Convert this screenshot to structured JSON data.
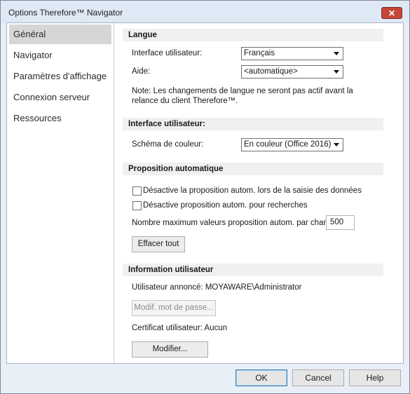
{
  "window": {
    "title": "Options Therefore™ Navigator",
    "close_glyph": "✕"
  },
  "sidebar": {
    "items": [
      {
        "label": "Général",
        "active": true
      },
      {
        "label": "Navigator",
        "active": false
      },
      {
        "label": "Paramètres d'affichage",
        "active": false
      },
      {
        "label": "Connexion serveur",
        "active": false
      },
      {
        "label": "Ressources",
        "active": false
      }
    ]
  },
  "langue": {
    "header": "Langue",
    "ui_label": "Interface utilisateur:",
    "ui_value": "Français",
    "help_label": "Aide:",
    "help_value": "<automatique>",
    "note_line1": "Note: Les changements de langue ne seront pas actif avant la",
    "note_line2": "relance du client Therefore™."
  },
  "interface": {
    "header": "Interface utilisateur:",
    "scheme_label": "Schéma de couleur:",
    "scheme_value": "En couleur (Office 2016)"
  },
  "autocomplete": {
    "header": "Proposition automatique",
    "check1_label": "Désactive la proposition autom. lors de la saisie des données",
    "check1_checked": false,
    "check2_label": "Désactive proposition autom. pour recherches",
    "check2_checked": false,
    "max_label": "Nombre maximum valeurs proposition autom. par champ:",
    "max_value": "500",
    "clear_button": "Effacer tout"
  },
  "userinfo": {
    "header": "Information utilisateur",
    "logged_user": "Utilisateur annoncé: MOYAWARE\\Administrator",
    "change_pwd_button": "Modif. mot de passe...",
    "certificate": "Certificat utilisateur: Aucun",
    "modify_button": "Modifier..."
  },
  "footer": {
    "ok": "OK",
    "cancel": "Cancel",
    "help": "Help"
  }
}
